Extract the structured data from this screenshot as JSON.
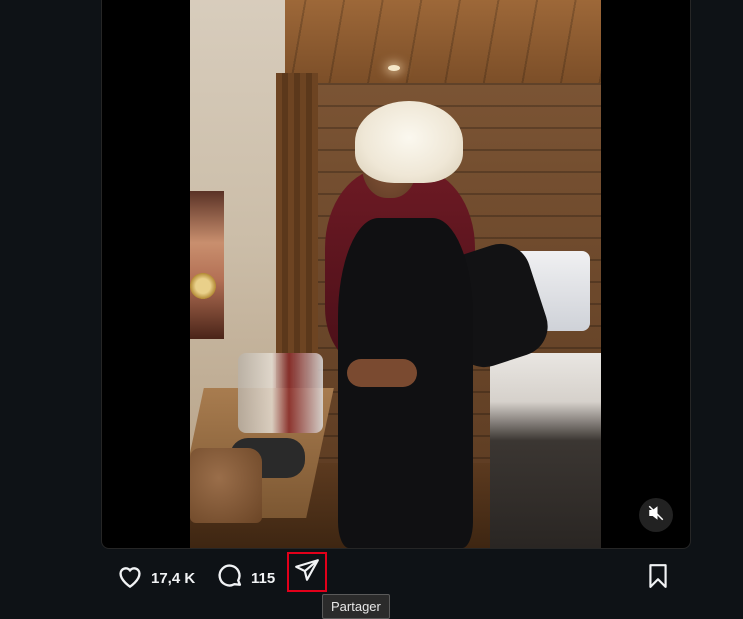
{
  "post": {
    "media_type": "video",
    "mute_icon": "speaker-muted-icon"
  },
  "actions": {
    "like_icon": "heart-icon",
    "like_count": "17,4 K",
    "comment_icon": "comment-bubble-icon",
    "comment_count": "115",
    "share_icon": "paper-plane-icon",
    "share_tooltip": "Partager",
    "bookmark_icon": "bookmark-icon"
  },
  "colors": {
    "background": "#0e1216",
    "text": "#f1f3f5",
    "highlight_box": "#e2001a"
  }
}
